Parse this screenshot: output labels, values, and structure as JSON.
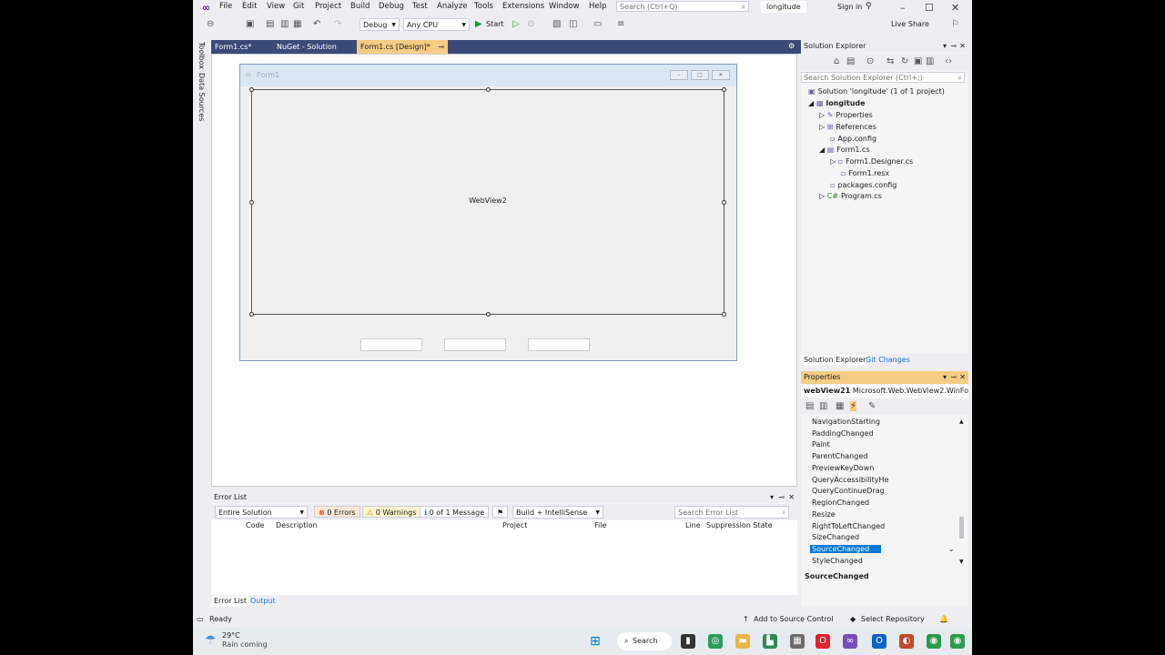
{
  "menu": {
    "items": [
      "File",
      "Edit",
      "View",
      "Git",
      "Project",
      "Build",
      "Debug",
      "Test",
      "Analyze",
      "Tools",
      "Extensions",
      "Window",
      "Help"
    ]
  },
  "search": {
    "placeholder": "Search (Ctrl+Q)"
  },
  "project_name": "longitude",
  "signin": "Sign in",
  "toolbar": {
    "config": "Debug",
    "platform": "Any CPU",
    "start": "Start",
    "live_share": "Live Share"
  },
  "left_strip": {
    "toolbox": "Toolbox",
    "data_sources": "Data Sources"
  },
  "tabs": [
    {
      "label": "Form1.cs*"
    },
    {
      "label": "NuGet - Solution"
    },
    {
      "label": "Form1.cs [Design]*"
    }
  ],
  "designer": {
    "form_title": "Form1",
    "webview_label": "WebView2"
  },
  "error_list": {
    "title": "Error List",
    "scope": "Entire Solution",
    "errors": "0 Errors",
    "warnings": "0 Warnings",
    "messages": "0 of 1 Message",
    "filter": "Build + IntelliSense",
    "search_placeholder": "Search Error List",
    "columns": [
      "Code",
      "Description",
      "Project",
      "File",
      "Line",
      "Suppression State"
    ],
    "bottom_tabs": [
      "Error List",
      "Output"
    ]
  },
  "solution_explorer": {
    "title": "Solution Explorer",
    "search_placeholder": "Search Solution Explorer (Ctrl+;)",
    "tree": [
      "Solution 'longitude' (1 of 1 project)",
      "longitude",
      "Properties",
      "References",
      "App.config",
      "Form1.cs",
      "Form1.Designer.cs",
      "Form1.resx",
      "packages.config",
      "Program.cs"
    ],
    "tabs": [
      "Solution Explorer",
      "Git Changes"
    ]
  },
  "properties": {
    "title": "Properties",
    "object": "webView21",
    "object_type": "Microsoft.Web.WebView2.WinFor",
    "events": [
      "NavigationStarting",
      "PaddingChanged",
      "Paint",
      "ParentChanged",
      "PreviewKeyDown",
      "QueryAccessibilityHe",
      "QueryContinueDrag",
      "RegionChanged",
      "Resize",
      "RightToLeftChanged",
      "SizeChanged",
      "SourceChanged",
      "StyleChanged"
    ],
    "selected": "SourceChanged",
    "description_title": "SourceChanged"
  },
  "status": {
    "ready": "Ready",
    "source_control": "Add to Source Control",
    "repo": "Select Repository"
  },
  "taskbar": {
    "temp": "29°C",
    "weather": "Rain coming",
    "search": "Search"
  },
  "colors": {
    "accent": "#f5cc84",
    "tab_bg": "#3c4a78",
    "selection": "#0078d7"
  }
}
